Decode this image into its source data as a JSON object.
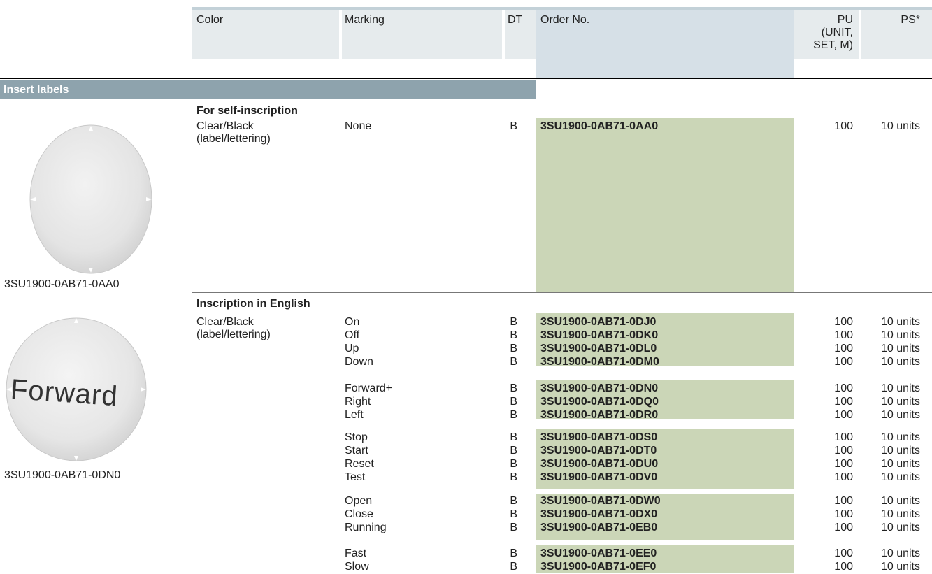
{
  "header": {
    "color": "Color",
    "marking": "Marking",
    "dt": "DT",
    "order_no": "Order No.",
    "pu_line1": "PU",
    "pu_line2": "(UNIT,",
    "pu_line3": "SET, M)",
    "ps": "PS*"
  },
  "section_title": "Insert labels",
  "self_inscription": {
    "heading": "For self-inscription",
    "color_line1": "Clear/Black",
    "color_line2": "(label/lettering)",
    "marking": "None",
    "dt": "B",
    "order_no": "3SU1900-0AB71-0AA0",
    "pu": "100",
    "ps": "10 units",
    "image_caption": "3SU1900-0AB71-0AA0"
  },
  "english": {
    "heading": "Inscription in English",
    "color_line1": "Clear/Black",
    "color_line2": "(label/lettering)",
    "image_text": "Forward",
    "image_caption": "3SU1900-0AB71-0DN0",
    "rows": [
      {
        "marking": "On",
        "dt": "B",
        "order_no": "3SU1900-0AB71-0DJ0",
        "pu": "100",
        "ps": "10 units"
      },
      {
        "marking": "Off",
        "dt": "B",
        "order_no": "3SU1900-0AB71-0DK0",
        "pu": "100",
        "ps": "10 units"
      },
      {
        "marking": "Up",
        "dt": "B",
        "order_no": "3SU1900-0AB71-0DL0",
        "pu": "100",
        "ps": "10 units"
      },
      {
        "marking": "Down",
        "dt": "B",
        "order_no": "3SU1900-0AB71-0DM0",
        "pu": "100",
        "ps": "10 units"
      },
      {
        "marking": "Forward+",
        "dt": "B",
        "order_no": "3SU1900-0AB71-0DN0",
        "pu": "100",
        "ps": "10 units"
      },
      {
        "marking": "Right",
        "dt": "B",
        "order_no": "3SU1900-0AB71-0DQ0",
        "pu": "100",
        "ps": "10 units"
      },
      {
        "marking": "Left",
        "dt": "B",
        "order_no": "3SU1900-0AB71-0DR0",
        "pu": "100",
        "ps": "10 units"
      },
      {
        "marking": "Stop",
        "dt": "B",
        "order_no": "3SU1900-0AB71-0DS0",
        "pu": "100",
        "ps": "10 units"
      },
      {
        "marking": "Start",
        "dt": "B",
        "order_no": "3SU1900-0AB71-0DT0",
        "pu": "100",
        "ps": "10 units"
      },
      {
        "marking": "Reset",
        "dt": "B",
        "order_no": "3SU1900-0AB71-0DU0",
        "pu": "100",
        "ps": "10 units"
      },
      {
        "marking": "Test",
        "dt": "B",
        "order_no": "3SU1900-0AB71-0DV0",
        "pu": "100",
        "ps": "10 units"
      },
      {
        "marking": "Open",
        "dt": "B",
        "order_no": "3SU1900-0AB71-0DW0",
        "pu": "100",
        "ps": "10 units"
      },
      {
        "marking": "Close",
        "dt": "B",
        "order_no": "3SU1900-0AB71-0DX0",
        "pu": "100",
        "ps": "10 units"
      },
      {
        "marking": "Running",
        "dt": "B",
        "order_no": "3SU1900-0AB71-0EB0",
        "pu": "100",
        "ps": "10 units"
      },
      {
        "marking": "Fast",
        "dt": "B",
        "order_no": "3SU1900-0AB71-0EE0",
        "pu": "100",
        "ps": "10 units"
      },
      {
        "marking": "Slow",
        "dt": "B",
        "order_no": "3SU1900-0AB71-0EF0",
        "pu": "100",
        "ps": "10 units"
      }
    ]
  },
  "colors": {
    "header_bg": "#e6ebed",
    "order_header_bg": "#d6e0e7",
    "section_bar": "#8ea3ad",
    "order_cell_bg": "#cbd6b7"
  }
}
